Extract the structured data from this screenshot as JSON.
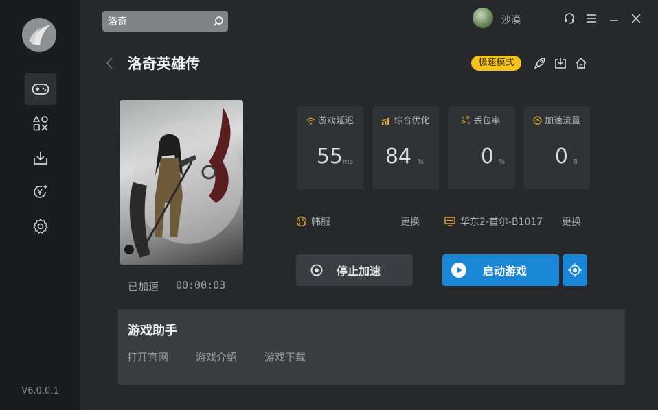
{
  "app": {
    "version": "V6.0.0.1",
    "search": {
      "value": "洛奇",
      "placeholder": ""
    },
    "user": {
      "name": "沙漠"
    }
  },
  "sidebar": {
    "items": [
      {
        "icon": "gamepad-icon",
        "active": true
      },
      {
        "icon": "apps-icon",
        "active": false
      },
      {
        "icon": "download-icon",
        "active": false
      },
      {
        "icon": "yen-coin-icon",
        "active": false
      },
      {
        "icon": "settings-gear-icon",
        "active": false
      }
    ]
  },
  "header": {
    "title": "洛奇英雄传",
    "mode_badge": "极速模式"
  },
  "game": {
    "status_label": "已加速",
    "timer": "00:00:03"
  },
  "stats": [
    {
      "label": "游戏延迟",
      "value": "55",
      "unit": "ms",
      "icon": "wifi-icon"
    },
    {
      "label": "综合优化",
      "value": "84",
      "unit": "%",
      "icon": "signal-bars-icon"
    },
    {
      "label": "丢包率",
      "value": "0",
      "unit": "%",
      "icon": "broken-link-icon"
    },
    {
      "label": "加速流量",
      "value": "0",
      "unit": "B",
      "icon": "flow-icon"
    }
  ],
  "server": {
    "region": "韩服",
    "region_change": "更换",
    "node": "华东2-首尔-B1017",
    "node_change": "更换"
  },
  "actions": {
    "stop": "停止加速",
    "launch": "启动游戏"
  },
  "assistant": {
    "title": "游戏助手",
    "links": [
      "打开官网",
      "游戏介绍",
      "游戏下载"
    ]
  },
  "colors": {
    "accent_blue": "#1a87d6",
    "badge_yellow": "#f6c21d",
    "sidebar_bg": "#1a1c1e",
    "main_bg": "#26282b"
  }
}
